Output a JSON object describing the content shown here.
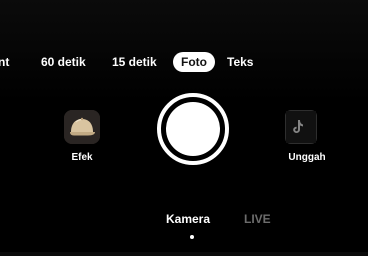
{
  "mode_tabs": {
    "cut": "nt",
    "sixty": "60 detik",
    "fifteen": "15 detik",
    "foto": "Foto",
    "teks": "Teks"
  },
  "effects": {
    "label": "Efek",
    "icon": "cap-icon"
  },
  "shutter": {
    "icon": "shutter-button"
  },
  "upload": {
    "label": "Unggah",
    "icon": "gallery-thumbnail-icon"
  },
  "bottom_tabs": {
    "kamera": "Kamera",
    "live": "LIVE"
  },
  "colors": {
    "background": "#000000",
    "active_text": "#ffffff",
    "inactive_text": "#6c6c6c",
    "selected_pill": "#ffffff"
  }
}
